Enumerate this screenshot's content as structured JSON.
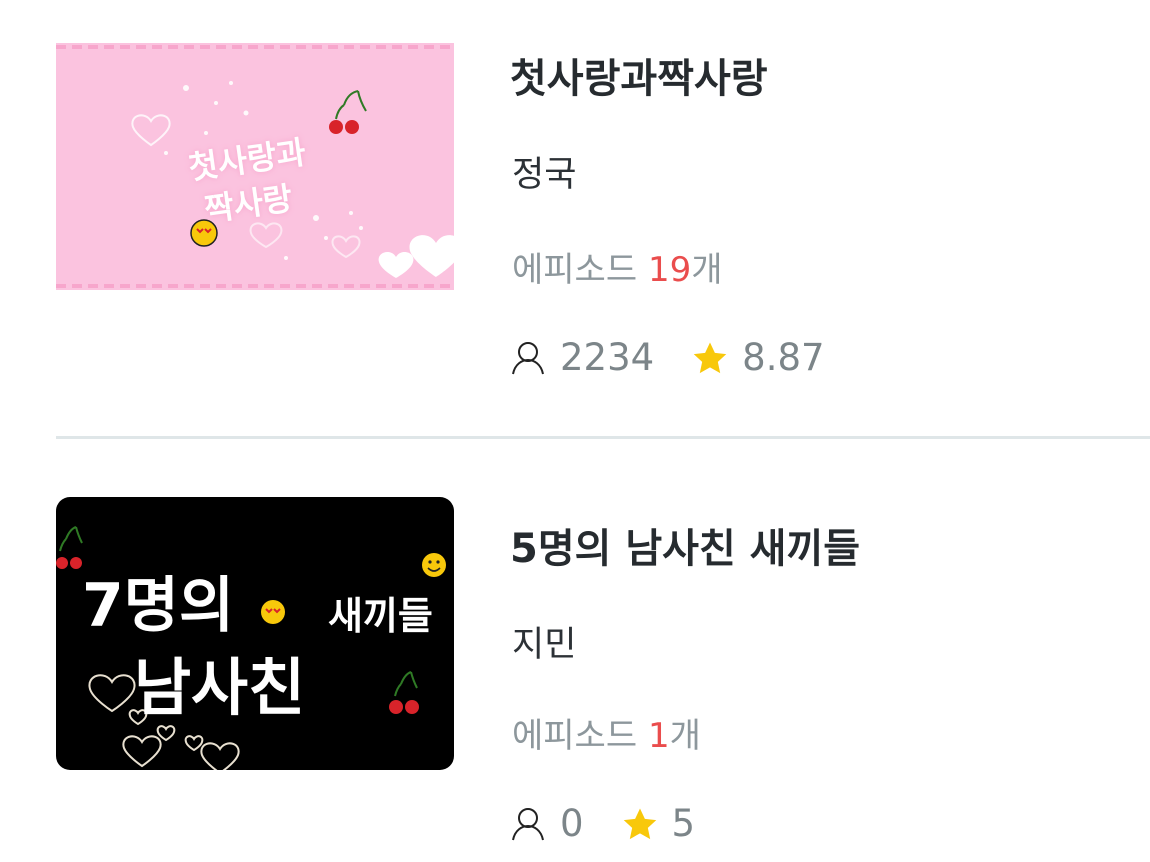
{
  "items": [
    {
      "title": "첫사랑과짝사랑",
      "author": "정국",
      "episodes_prefix": "에피소드",
      "episodes_count": "19",
      "episodes_suffix": "개",
      "views": "2234",
      "rating": "8.87",
      "thumbnail_text_line1": "첫사랑과",
      "thumbnail_text_line2": "짝사랑"
    },
    {
      "title": "5명의 남사친 새끼들",
      "author": "지민",
      "episodes_prefix": "에피소드",
      "episodes_count": "1",
      "episodes_suffix": "개",
      "views": "0",
      "rating": "5",
      "thumbnail_text_line1": "7명의",
      "thumbnail_text_line2": "남사친",
      "thumbnail_text_line3": "새끼들"
    }
  ],
  "colors": {
    "episode_count": "#ea4d4d",
    "star": "#f8c80b",
    "divider": "#dfe6e8"
  },
  "icons": [
    "user-icon",
    "star-icon",
    "heart-icon",
    "cherry-icon",
    "emoji-icon"
  ]
}
